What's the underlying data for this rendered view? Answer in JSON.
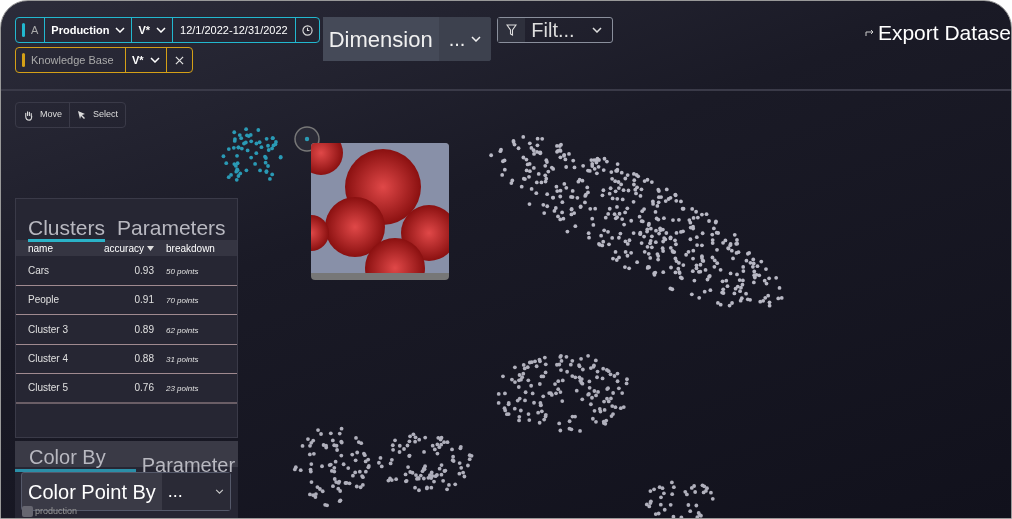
{
  "filters": [
    {
      "kind": "primary",
      "color": "#22b8cf",
      "label": "A",
      "dataset": "Production",
      "version": "V*",
      "date_range": "12/1/2022-12/31/2022"
    },
    {
      "kind": "reference",
      "color": "#d4a017",
      "dataset": "Knowledge Base",
      "version": "V*"
    }
  ],
  "dimension": {
    "label": "Dimension",
    "value": "..."
  },
  "filter_button": {
    "label": "Filt..."
  },
  "export_button": {
    "label": "Export Datase"
  },
  "tools": [
    {
      "kind": "move",
      "label": "Move"
    },
    {
      "kind": "select",
      "label": "Select"
    }
  ],
  "clusters_panel": {
    "tabs": [
      {
        "label": "Clusters",
        "selected": true
      },
      {
        "label": "Parameters",
        "selected": false
      }
    ],
    "columns": [
      {
        "label": "name",
        "sorted": false
      },
      {
        "label": "accuracy",
        "sorted": true
      },
      {
        "label": "breakdown",
        "sorted": false
      }
    ],
    "rows": [
      {
        "name": "Cars",
        "accuracy": "0.93",
        "breakdown": "50 points"
      },
      {
        "name": "People",
        "accuracy": "0.91",
        "breakdown": "70 points"
      },
      {
        "name": "Cluster 3",
        "accuracy": "0.89",
        "breakdown": "62 points"
      },
      {
        "name": "Cluster 4",
        "accuracy": "0.88",
        "breakdown": "31 points"
      },
      {
        "name": "Cluster 5",
        "accuracy": "0.76",
        "breakdown": "23 points"
      }
    ]
  },
  "color_panel": {
    "tabs": [
      {
        "label": "Color By",
        "selected": true
      },
      {
        "label": "Parameter",
        "selected": false
      }
    ],
    "select": {
      "label": "Color Point By",
      "value": "..."
    },
    "legend": [
      {
        "label": "production",
        "checked": false
      }
    ]
  }
}
